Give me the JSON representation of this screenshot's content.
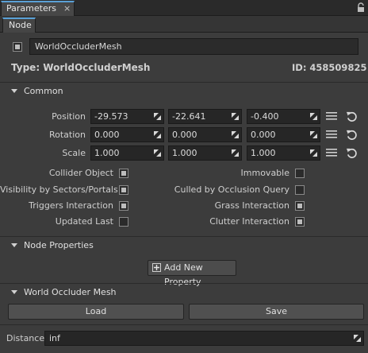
{
  "tabs": {
    "panel_tab": "Parameters",
    "close_glyph": "×",
    "sub_tab": "Node"
  },
  "node": {
    "name": "WorldOccluderMesh",
    "enabled": true
  },
  "info": {
    "type_text": "Type:  WorldOccluderMesh",
    "id_text": "ID:  458509825"
  },
  "common": {
    "title": "Common",
    "rows": [
      {
        "label": "Position",
        "values": [
          "-29.573",
          "-22.641",
          "-0.400"
        ]
      },
      {
        "label": "Rotation",
        "values": [
          "0.000",
          "0.000",
          "0.000"
        ]
      },
      {
        "label": "Scale",
        "values": [
          "1.000",
          "1.000",
          "1.000"
        ]
      }
    ],
    "flags_left": [
      {
        "label": "Collider Object",
        "checked": true
      },
      {
        "label": "Visibility by Sectors/Portals",
        "checked": true
      },
      {
        "label": "Triggers Interaction",
        "checked": true
      },
      {
        "label": "Updated Last",
        "checked": false
      }
    ],
    "flags_right": [
      {
        "label": "Immovable",
        "checked": false
      },
      {
        "label": "Culled by Occlusion Query",
        "checked": false
      },
      {
        "label": "Grass Interaction",
        "checked": true
      },
      {
        "label": "Clutter Interaction",
        "checked": true
      }
    ]
  },
  "node_properties": {
    "title": "Node Properties",
    "add_label": "Add New Property"
  },
  "occluder": {
    "title": "World Occluder Mesh",
    "load_label": "Load",
    "save_label": "Save",
    "distance_label": "Distance",
    "distance_value": "inf"
  }
}
